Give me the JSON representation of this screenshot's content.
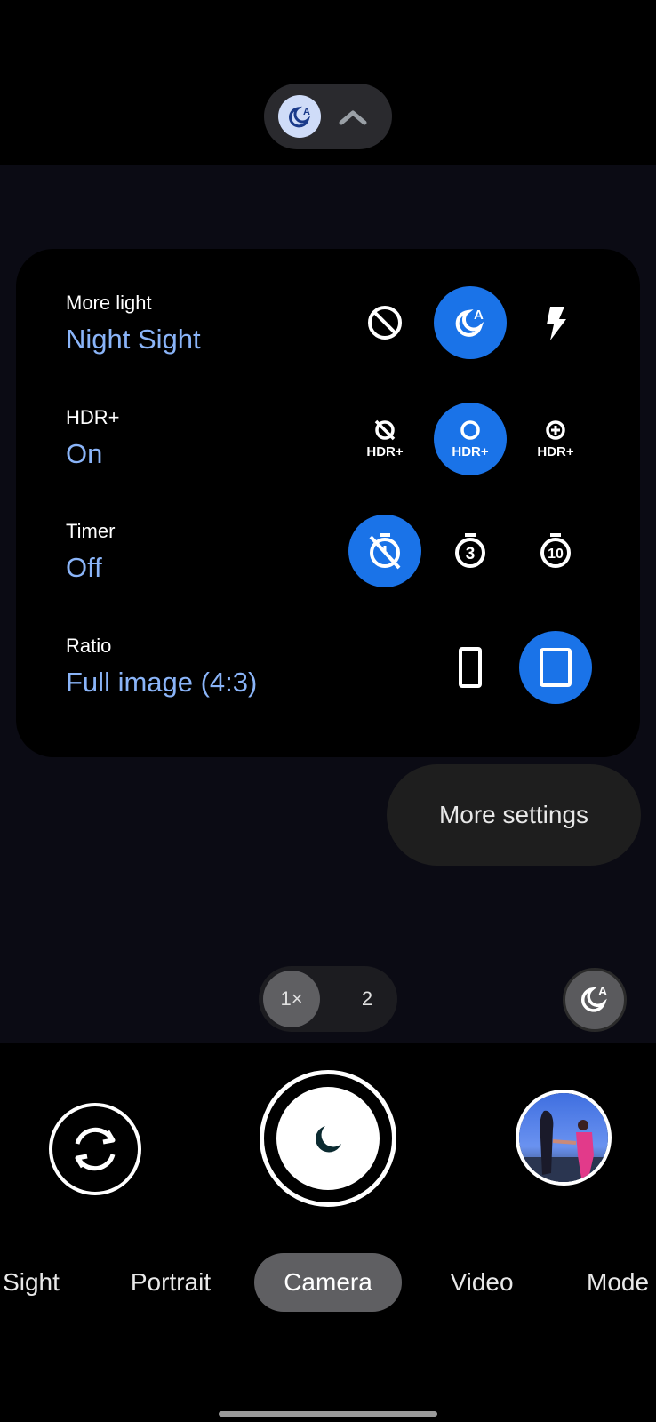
{
  "top_bar": {
    "active_icon": "night-sight-auto-icon",
    "expand_icon": "chevron-up-icon"
  },
  "settings": [
    {
      "label": "More light",
      "value": "Night Sight",
      "options": [
        {
          "icon": "off-icon",
          "selected": false
        },
        {
          "icon": "night-sight-auto-icon",
          "selected": true
        },
        {
          "icon": "flash-icon",
          "selected": false
        }
      ]
    },
    {
      "label": "HDR+",
      "value": "On",
      "options": [
        {
          "icon": "hdr-off-icon",
          "text": "HDR+",
          "selected": false
        },
        {
          "icon": "hdr-on-icon",
          "text": "HDR+",
          "selected": true
        },
        {
          "icon": "hdr-enhanced-icon",
          "text": "HDR+",
          "selected": false
        }
      ]
    },
    {
      "label": "Timer",
      "value": "Off",
      "options": [
        {
          "icon": "timer-off-icon",
          "selected": true
        },
        {
          "icon": "timer-3-icon",
          "text": "3",
          "selected": false
        },
        {
          "icon": "timer-10-icon",
          "text": "10",
          "selected": false
        }
      ]
    },
    {
      "label": "Ratio",
      "value": "Full image (4:3)",
      "options": [
        {
          "icon": "ratio-tall-icon",
          "selected": false
        },
        {
          "icon": "ratio-full-icon",
          "selected": true
        }
      ]
    }
  ],
  "more_settings_label": "More settings",
  "zoom": {
    "options": [
      "1×",
      "2"
    ],
    "selected": "1×"
  },
  "night_badge_icon": "night-sight-auto-icon",
  "modes": [
    "Sight",
    "Portrait",
    "Camera",
    "Video",
    "Mode"
  ],
  "active_mode": "Camera",
  "colors": {
    "accent": "#1a73e8",
    "value_text": "#8ab4f8",
    "panel": "#000000",
    "chip": "#2a2a2e"
  }
}
